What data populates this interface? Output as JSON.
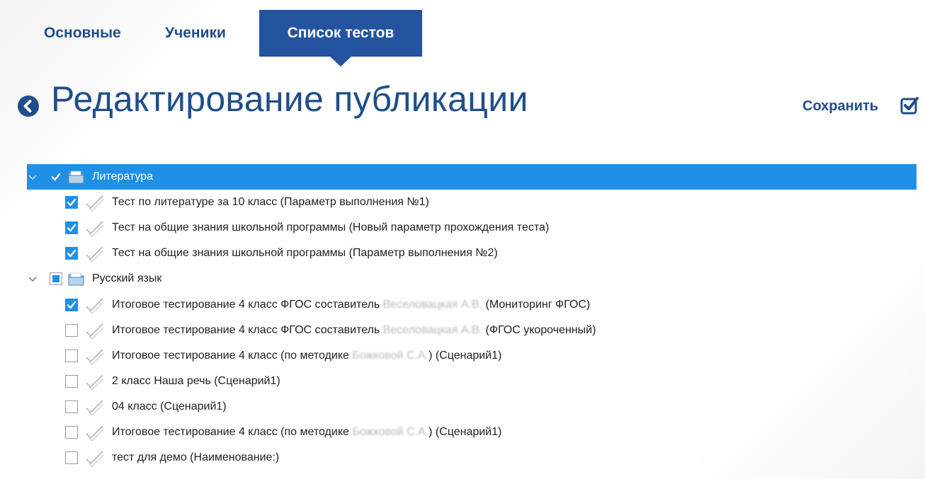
{
  "tabs": {
    "basic": "Основные",
    "students": "Ученики",
    "tests": "Список тестов"
  },
  "header": {
    "title": "Редактирование публикации",
    "save_label": "Сохранить",
    "back_icon": "chevron-left-circle-icon",
    "save_icon": "checkbox-check-icon"
  },
  "colors": {
    "brand": "#1f4e8a",
    "active_tab": "#2453a0",
    "selection": "#1f90e6"
  },
  "tree": {
    "group1": {
      "label": "Литература",
      "state": "checked",
      "expanded": true,
      "selected": true,
      "items": [
        {
          "label": "Тест по литературе за 10 класс (Параметр выполнения №1)",
          "checked": true
        },
        {
          "label": "Тест на общие знания школьной программы (Новый параметр прохождения теста)",
          "checked": true
        },
        {
          "label": "Тест на общие знания школьной программы (Параметр выполнения №2)",
          "checked": true
        }
      ]
    },
    "group2": {
      "label": "Русский язык",
      "state": "indeterminate",
      "expanded": true,
      "items": [
        {
          "pre": "Итоговое тестирование 4 класс ФГОС составитель ",
          "blur": "Веселовацкая А.В.",
          "post": " (Мониторинг ФГОС)",
          "checked": true
        },
        {
          "pre": "Итоговое тестирование 4 класс ФГОС составитель ",
          "blur": "Веселовацкая А.В.",
          "post": " (ФГОС укороченный)",
          "checked": false
        },
        {
          "pre": "Итоговое тестирование 4 класс (по методике ",
          "blur": "Божковой С.А.",
          "post": ") (Сценарий1)",
          "checked": false
        },
        {
          "label": "2 класс Наша речь (Сценарий1)",
          "checked": false
        },
        {
          "label": "04 класс (Сценарий1)",
          "checked": false
        },
        {
          "pre": "Итоговое тестирование 4 класс (по методике ",
          "blur": "Божковой С.А.",
          "post": ") (Сценарий1)",
          "checked": false
        },
        {
          "label": "тест для демо (Наименование:)",
          "checked": false
        }
      ]
    }
  }
}
